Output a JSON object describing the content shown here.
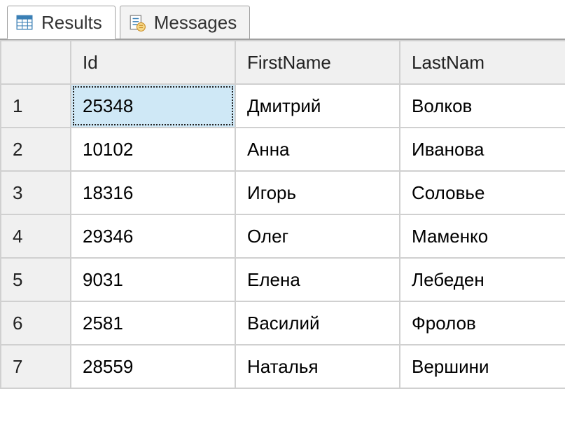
{
  "tabs": {
    "results": "Results",
    "messages": "Messages"
  },
  "columns": {
    "id": "Id",
    "firstName": "FirstName",
    "lastName": "LastNam"
  },
  "rows": [
    {
      "n": "1",
      "id": "25348",
      "first": "Дмитрий",
      "last": "Волков"
    },
    {
      "n": "2",
      "id": "10102",
      "first": "Анна",
      "last": "Иванова"
    },
    {
      "n": "3",
      "id": "18316",
      "first": "Игорь",
      "last": "Соловье"
    },
    {
      "n": "4",
      "id": "29346",
      "first": "Олег",
      "last": "Маменко"
    },
    {
      "n": "5",
      "id": "9031",
      "first": "Елена",
      "last": "Лебеден"
    },
    {
      "n": "6",
      "id": "2581",
      "first": "Василий",
      "last": "Фролов"
    },
    {
      "n": "7",
      "id": "28559",
      "first": "Наталья",
      "last": "Вершини"
    }
  ]
}
